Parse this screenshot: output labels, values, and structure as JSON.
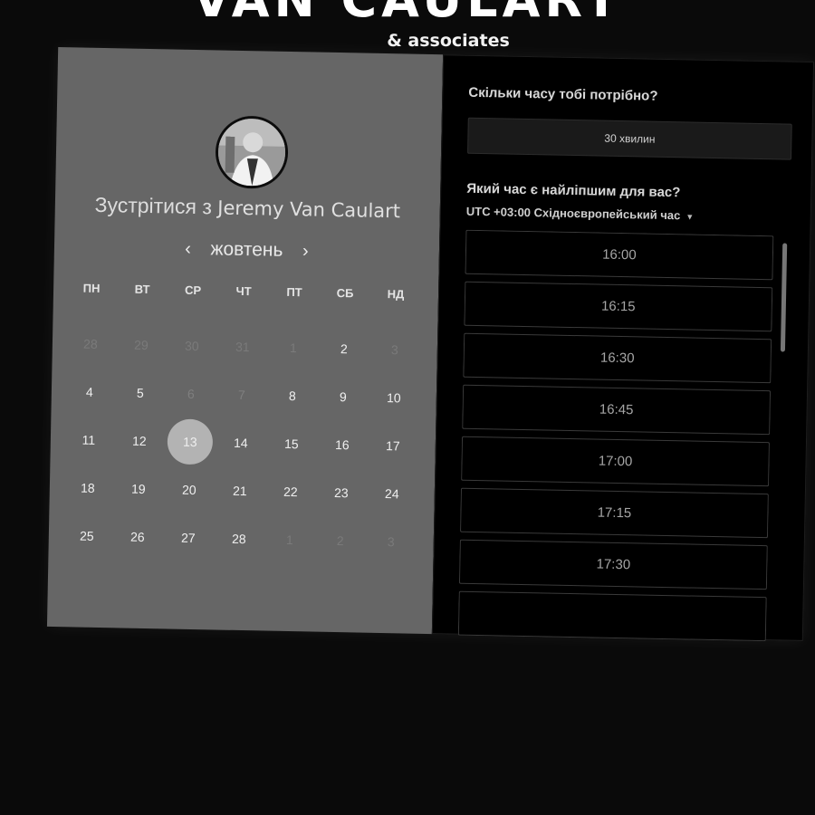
{
  "brand": {
    "title": "VAN CAULART",
    "subtitle": "& associates"
  },
  "left": {
    "title_prefix": "Зустрітися з",
    "title_name": "Jeremy Van Caulart",
    "month": "жовтень",
    "prev_arrow": "‹",
    "next_arrow": "›",
    "weekdays": [
      "ПН",
      "ВТ",
      "СР",
      "ЧТ",
      "ПТ",
      "СБ",
      "НД"
    ],
    "weeks": [
      [
        {
          "d": "28",
          "s": "muted"
        },
        {
          "d": "29",
          "s": "muted"
        },
        {
          "d": "30",
          "s": "muted"
        },
        {
          "d": "31",
          "s": "muted"
        },
        {
          "d": "1",
          "s": "muted"
        },
        {
          "d": "2",
          "s": "avail"
        },
        {
          "d": "3",
          "s": "muted"
        }
      ],
      [
        {
          "d": "4",
          "s": "avail"
        },
        {
          "d": "5",
          "s": "avail"
        },
        {
          "d": "6",
          "s": "unavail"
        },
        {
          "d": "7",
          "s": "unavail"
        },
        {
          "d": "8",
          "s": "avail"
        },
        {
          "d": "9",
          "s": "avail"
        },
        {
          "d": "10",
          "s": "avail"
        }
      ],
      [
        {
          "d": "11",
          "s": "avail"
        },
        {
          "d": "12",
          "s": "avail"
        },
        {
          "d": "13",
          "s": "selected"
        },
        {
          "d": "14",
          "s": "avail"
        },
        {
          "d": "15",
          "s": "avail"
        },
        {
          "d": "16",
          "s": "avail"
        },
        {
          "d": "17",
          "s": "avail"
        }
      ],
      [
        {
          "d": "18",
          "s": "avail"
        },
        {
          "d": "19",
          "s": "avail"
        },
        {
          "d": "20",
          "s": "avail"
        },
        {
          "d": "21",
          "s": "avail"
        },
        {
          "d": "22",
          "s": "avail"
        },
        {
          "d": "23",
          "s": "avail"
        },
        {
          "d": "24",
          "s": "avail"
        }
      ],
      [
        {
          "d": "25",
          "s": "avail"
        },
        {
          "d": "26",
          "s": "avail"
        },
        {
          "d": "27",
          "s": "avail"
        },
        {
          "d": "28",
          "s": "avail"
        },
        {
          "d": "1",
          "s": "muted"
        },
        {
          "d": "2",
          "s": "muted"
        },
        {
          "d": "3",
          "s": "muted"
        }
      ]
    ]
  },
  "right": {
    "duration_question": "Скільки часу тобі потрібно?",
    "duration_value": "30 хвилин",
    "time_question": "Який час є найліпшим для вас?",
    "timezone": "UTC +03:00 Східноєвропейський час",
    "slots": [
      "16:00",
      "16:15",
      "16:30",
      "16:45",
      "17:00",
      "17:15",
      "17:30",
      ""
    ]
  }
}
